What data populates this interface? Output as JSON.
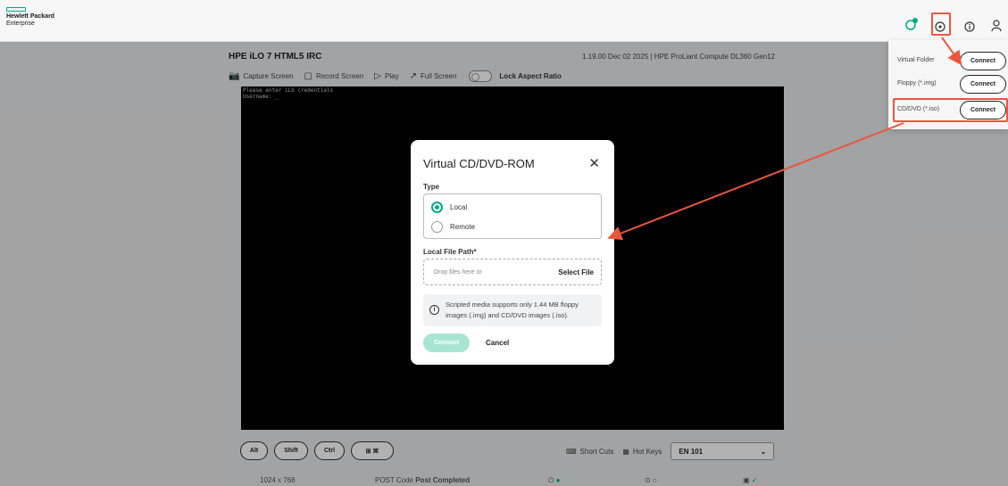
{
  "header": {
    "logo_line1": "Hewlett Packard",
    "logo_line2": "Enterprise",
    "icons": [
      "health-status-icon",
      "virtual-media-icon",
      "info-icon",
      "user-icon"
    ]
  },
  "irc": {
    "title": "HPE iLO 7 HTML5 IRC",
    "version_info": "1.19.00 Dec 02 2025  |  HPE ProLiant Compute DL360 Gen12",
    "toolbar": {
      "capture": "Capture Screen",
      "record": "Record Screen",
      "play": "Play",
      "fullscreen": "Full Screen",
      "lock_aspect": "Lock Aspect Ratio"
    },
    "console_lines": "Please enter iLO credentials\nUsername: _",
    "keys": [
      "Alt",
      "Shift",
      "Ctrl",
      "⊞ ⌘"
    ],
    "shortcuts": "Short Cuts",
    "hotkeys": "Hot Keys",
    "keyboard_layout": "EN 101",
    "status": {
      "resolution": "1024 x 768",
      "post_label": "POST Code",
      "post_value": "Post Completed"
    }
  },
  "vm_panel": {
    "rows": [
      {
        "label": "Virtual Folder",
        "button": "Connect"
      },
      {
        "label": "Floppy (*.img)",
        "button": "Connect"
      },
      {
        "label": "CD/DVD (*.iso)",
        "button": "Connect"
      }
    ]
  },
  "modal": {
    "title": "Virtual CD/DVD-ROM",
    "type_label": "Type",
    "option_local": "Local",
    "option_remote": "Remote",
    "path_label": "Local File Path*",
    "drop_placeholder": "Drop files here or",
    "select_file": "Select File",
    "info": "Scripted media supports only 1.44 MB floppy images (.img) and CD/DVD images (.iso).",
    "connect": "Connect",
    "cancel": "Cancel"
  },
  "colors": {
    "accent": "#01a982",
    "annotation": "#e9573f"
  }
}
